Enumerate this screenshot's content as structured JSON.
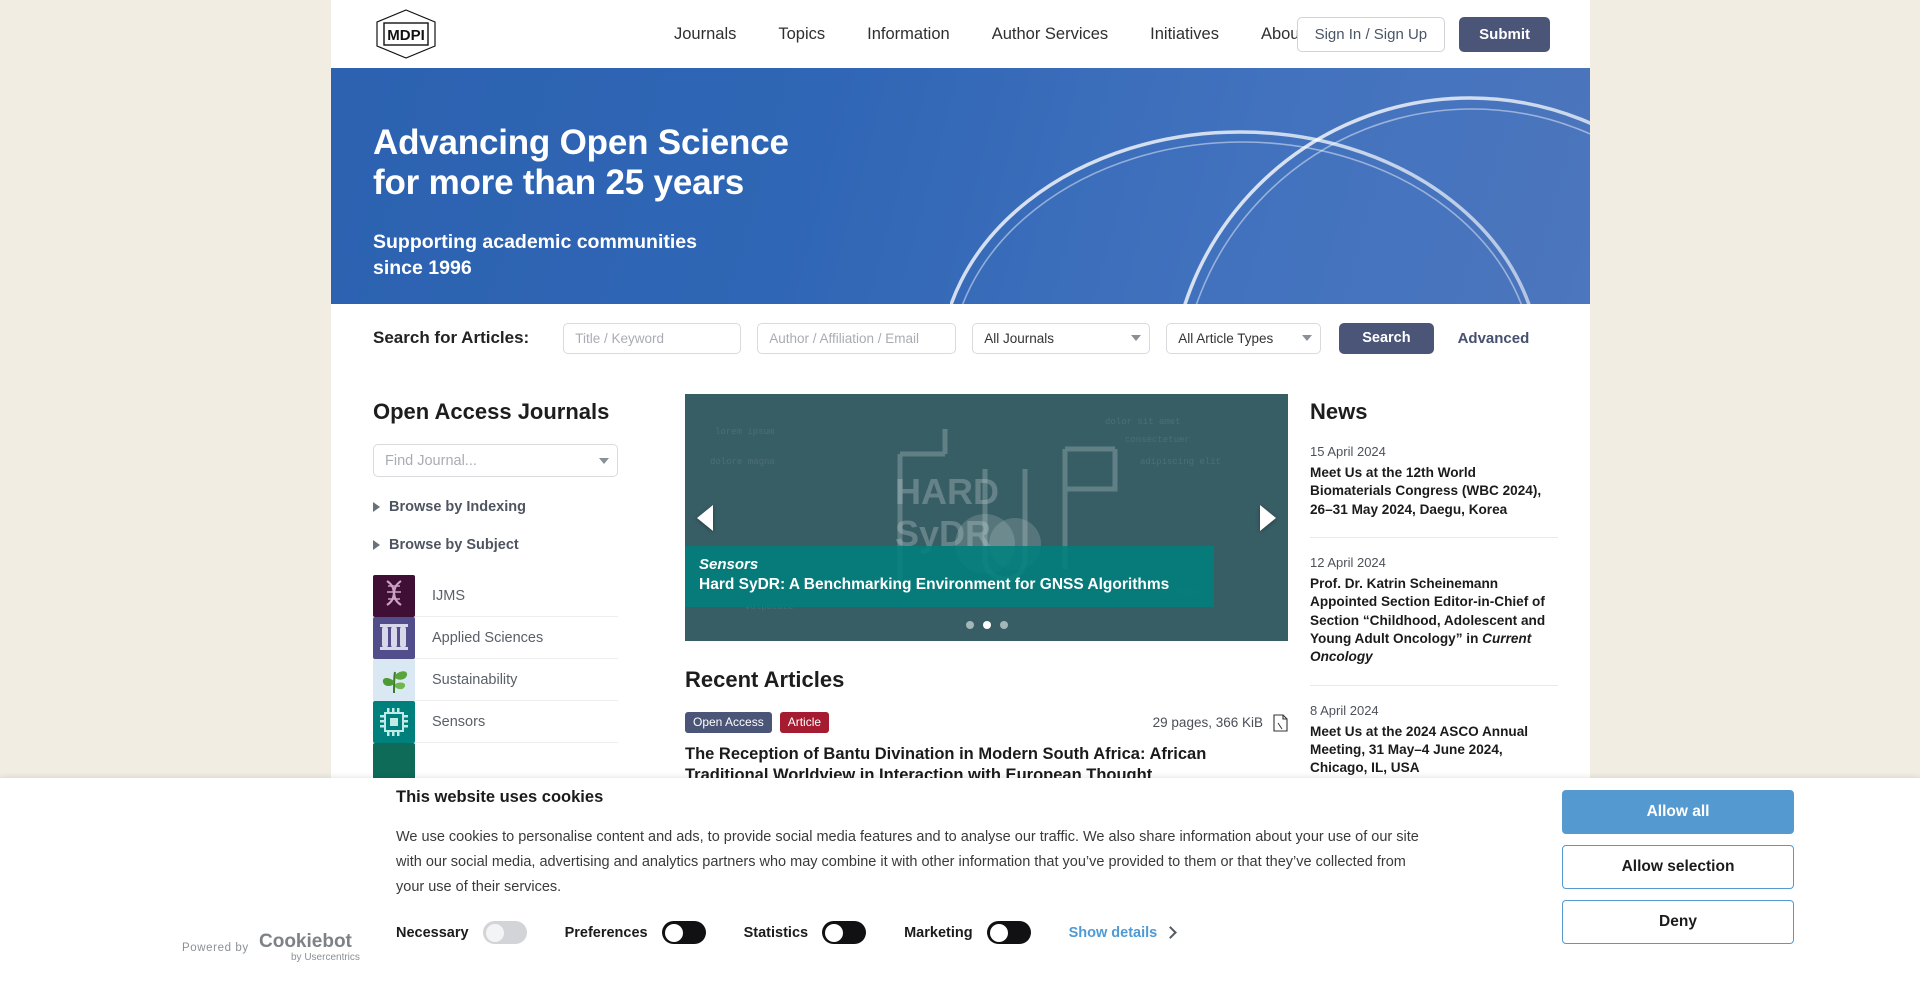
{
  "header": {
    "logo_alt": "MDPI",
    "nav": [
      {
        "label": "Journals"
      },
      {
        "label": "Topics"
      },
      {
        "label": "Information"
      },
      {
        "label": "Author Services"
      },
      {
        "label": "Initiatives"
      },
      {
        "label": "About"
      }
    ],
    "sign_in_label": "Sign In / Sign Up",
    "submit_label": "Submit"
  },
  "hero": {
    "title_line1": "Advancing Open Science",
    "title_line2": "for more than 25 years",
    "sub_line1": "Supporting academic communities",
    "sub_line2": "since 1996",
    "bg_color": "#2f66b5"
  },
  "search": {
    "label": "Search for Articles:",
    "title_placeholder": "Title / Keyword",
    "title_value": "",
    "author_placeholder": "Author / Affiliation / Email",
    "author_value": "",
    "journals_selected": "All Journals",
    "types_selected": "All Article Types",
    "search_button": "Search",
    "advanced_link": "Advanced"
  },
  "journals_panel": {
    "title": "Open Access Journals",
    "find_placeholder": "Find Journal...",
    "browse_indexing": "Browse by Indexing",
    "browse_subject": "Browse by Subject",
    "items": [
      {
        "name": "IJMS",
        "icon": "dna-icon",
        "color": "#3f0f35"
      },
      {
        "name": "Applied Sciences",
        "icon": "test-tubes-icon",
        "color": "#524e8c"
      },
      {
        "name": "Sustainability",
        "icon": "leaf-icon",
        "color": "#d9e8f2"
      },
      {
        "name": "Sensors",
        "icon": "chip-icon",
        "color": "#00807c"
      },
      {
        "name": "",
        "icon": "journal-icon",
        "color": "#0e6b58"
      }
    ]
  },
  "carousel": {
    "journal": "Sensors",
    "headline": "Hard SyDR: A Benchmarking Environment for GNSS Algorithms",
    "prev_label": "Previous slide",
    "next_label": "Next slide",
    "dots": 3,
    "active_dot": 1,
    "accent_color": "#00807c"
  },
  "recent": {
    "title": "Recent Articles",
    "articles": [
      {
        "access_badge": "Open Access",
        "type_badge": "Article",
        "size": "29 pages, 366 KiB",
        "title": "The Reception of Bantu Divination in Modern South Africa: African Traditional Worldview in Interaction with European Thought"
      }
    ]
  },
  "news": {
    "title": "News",
    "items": [
      {
        "date": "15 April 2024",
        "headline": "Meet Us at the 12th World Biomaterials Congress (WBC 2024), 26–31 May 2024, Daegu, Korea",
        "emphasis": ""
      },
      {
        "date": "12 April 2024",
        "headline": "Prof. Dr. Katrin Scheinemann Appointed Section Editor-in-Chief of Section “Childhood, Adolescent and Young Adult Oncology” in ",
        "emphasis": "Current Oncology"
      },
      {
        "date": "8 April 2024",
        "headline": "Meet Us at the 2024 ASCO Annual Meeting, 31 May–4 June 2024, Chicago, IL, USA",
        "emphasis": ""
      }
    ]
  },
  "cookie_banner": {
    "title": "This website uses cookies",
    "body": "We use cookies to personalise content and ads, to provide social media features and to analyse our traffic. We also share information about your use of our site with our social media, advertising and analytics partners who may combine it with other information that you’ve provided to them or that they’ve collected from your use of their services.",
    "toggles": [
      {
        "label": "Necessary",
        "state": "on-locked"
      },
      {
        "label": "Preferences",
        "state": "off"
      },
      {
        "label": "Statistics",
        "state": "off"
      },
      {
        "label": "Marketing",
        "state": "off"
      }
    ],
    "show_details": "Show details",
    "buttons": {
      "allow_all": "Allow all",
      "allow_selection": "Allow selection",
      "deny": "Deny"
    },
    "powered_by": "Powered by",
    "provider": "Cookiebot",
    "provider_sub": "by Usercentrics",
    "primary_color": "#5499d0"
  }
}
